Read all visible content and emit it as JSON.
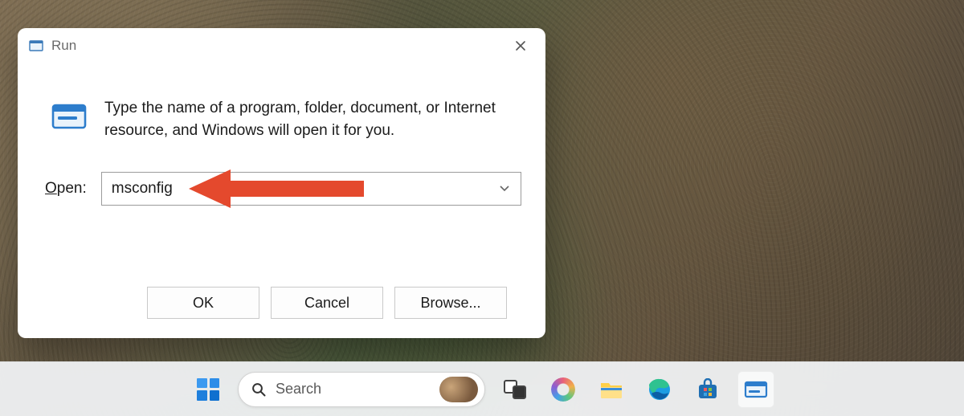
{
  "dialog": {
    "title": "Run",
    "description": "Type the name of a program, folder, document, or Internet resource, and Windows will open it for you.",
    "open_label_prefix": "O",
    "open_label_rest": "pen:",
    "input_value": "msconfig",
    "ok_label": "OK",
    "cancel_label": "Cancel",
    "browse_label": "Browse..."
  },
  "taskbar": {
    "search_placeholder": "Search"
  }
}
